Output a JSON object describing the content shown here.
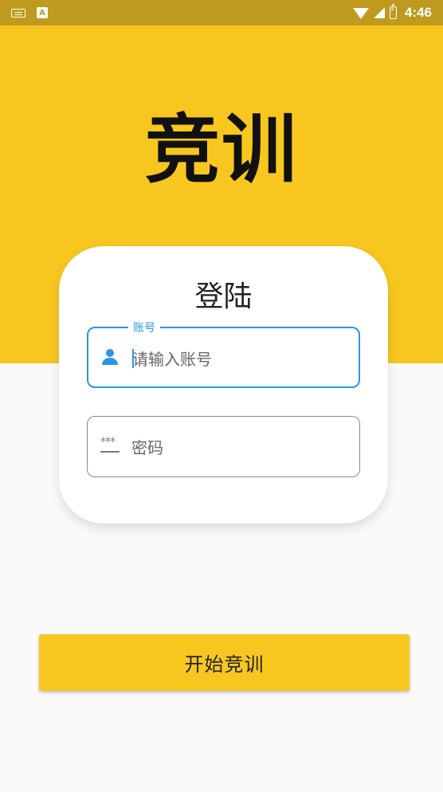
{
  "status_bar": {
    "time": "4:46",
    "a_badge": "A"
  },
  "app": {
    "logo": "竞训"
  },
  "login_card": {
    "title": "登陆",
    "account_field": {
      "label": "账号",
      "placeholder": "请输入账号",
      "icon": "person-icon"
    },
    "password_field": {
      "placeholder": "密码",
      "icon": "password-dots-icon",
      "icon_glyph": "***"
    }
  },
  "start_button": {
    "label": "开始竞训"
  },
  "colors": {
    "brand_yellow": "#f7c720",
    "status_bar": "#be9a1e",
    "focus_blue": "#2b96e6"
  }
}
